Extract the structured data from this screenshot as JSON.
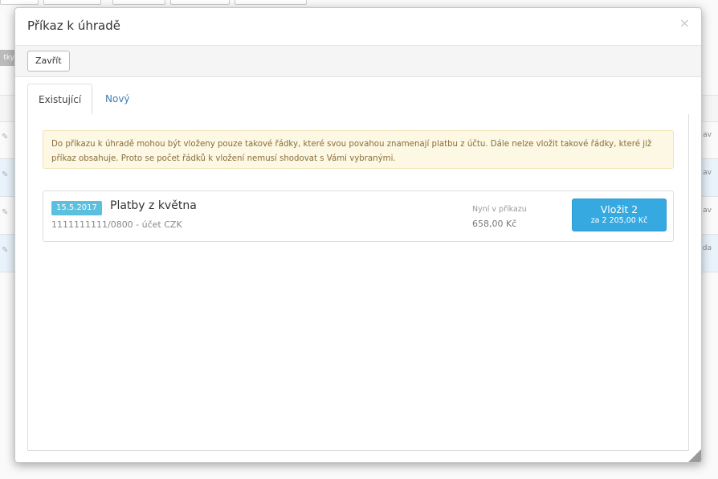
{
  "background": {
    "tag_text": "tky",
    "row_texts": [
      "av",
      "av",
      "av",
      "da"
    ]
  },
  "modal": {
    "title": "Příkaz k úhradě",
    "close_symbol": "×",
    "close_button_label": "Zavřít",
    "tabs": [
      {
        "label": "Existující",
        "active": true
      },
      {
        "label": "Nový",
        "active": false
      }
    ],
    "notice": "Do příkazu k úhradě mohou být vloženy pouze takové řádky, které svou povahou znamenají platbu z účtu. Dále nelze vložit takové řádky, které již příkaz obsahuje. Proto se počet řádků k vložení nemusí shodovat s Vámi vybranými.",
    "order": {
      "date": "15.5.2017",
      "name": "Platby z května",
      "account": "1111111111/0800 - účet CZK",
      "in_order_label": "Nyní v příkazu",
      "in_order_amount": "658,00 Kč",
      "insert_label": "Vložit 2",
      "insert_sublabel": "za 2 205,00 Kč"
    }
  },
  "colors": {
    "accent": "#36a9e1",
    "badge": "#5bc0de",
    "warning_bg": "#fcf8e3",
    "warning_text": "#8a6d3b",
    "link": "#3c7cb3"
  }
}
